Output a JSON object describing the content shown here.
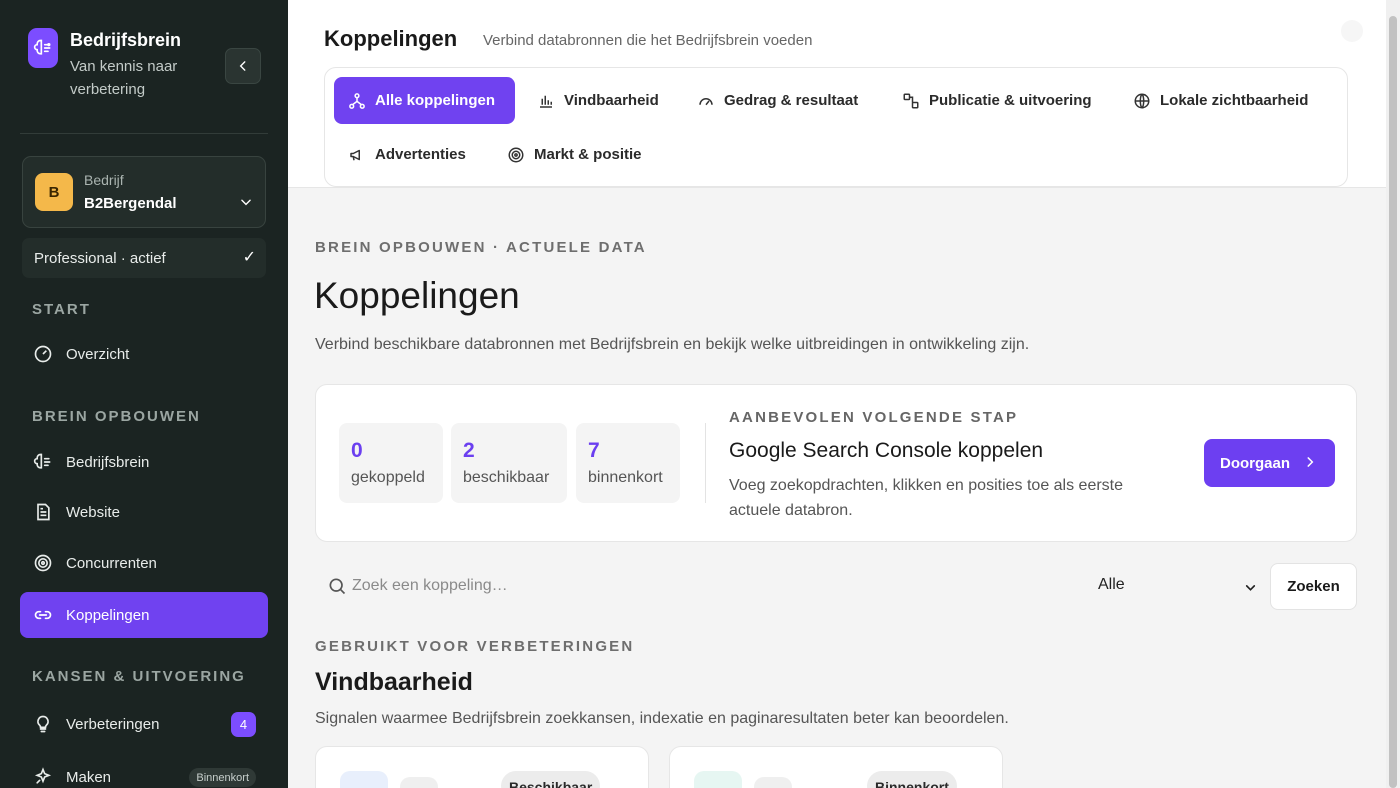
{
  "sidebar": {
    "brand_title": "Bedrijfsbrein",
    "brand_subtitle": "Van kennis naar verbetering",
    "company_label": "Bedrijf",
    "company_name": "B2Bergendal",
    "company_initial": "B",
    "plan": "Professional · actief",
    "sections": {
      "start": "START",
      "brein": "BREIN OPBOUWEN",
      "kansen": "KANSEN & UITVOERING"
    },
    "items": [
      {
        "label": "Overzicht",
        "icon": "gauge-icon"
      },
      {
        "label": "Bedrijfsbrein",
        "icon": "brain-icon"
      },
      {
        "label": "Website",
        "icon": "document-icon"
      },
      {
        "label": "Concurrenten",
        "icon": "target-icon"
      },
      {
        "label": "Koppelingen",
        "icon": "link-icon",
        "active": true
      },
      {
        "label": "Verbeteringen",
        "icon": "lightbulb-icon",
        "count": "4"
      },
      {
        "label": "Maken",
        "icon": "sparkle-icon",
        "badge": "Binnenkort"
      }
    ]
  },
  "header": {
    "title": "Koppelingen",
    "subtitle": "Verbind databronnen die het Bedrijfsbrein voeden",
    "tabs": [
      {
        "label": "Alle koppelingen",
        "icon": "network-icon",
        "active": true
      },
      {
        "label": "Vindbaarheid",
        "icon": "bar-chart-icon"
      },
      {
        "label": "Gedrag & resultaat",
        "icon": "speedometer-icon"
      },
      {
        "label": "Publicatie & uitvoering",
        "icon": "workflow-icon"
      },
      {
        "label": "Lokale zichtbaarheid",
        "icon": "globe-icon"
      },
      {
        "label": "Advertenties",
        "icon": "megaphone-icon"
      },
      {
        "label": "Markt & positie",
        "icon": "target-icon"
      }
    ]
  },
  "main": {
    "eyebrow": "BREIN OPBOUWEN · ACTUELE DATA",
    "title": "Koppelingen",
    "description": "Verbind beschikbare databronnen met Bedrijfsbrein en bekijk welke uitbreidingen in ontwikkeling zijn.",
    "stats": [
      {
        "value": "0",
        "label": "gekoppeld"
      },
      {
        "value": "2",
        "label": "beschikbaar"
      },
      {
        "value": "7",
        "label": "binnenkort"
      }
    ],
    "recommendation": {
      "eyebrow": "AANBEVOLEN VOLGENDE STAP",
      "title": "Google Search Console koppelen",
      "description": "Voeg zoekopdrachten, klikken en posities toe als eerste actuele databron.",
      "button": "Doorgaan"
    },
    "search": {
      "placeholder": "Zoek een koppeling…",
      "filter_value": "Alle",
      "button": "Zoeken"
    },
    "section": {
      "eyebrow": "GEBRUIKT VOOR VERBETERINGEN",
      "title": "Vindbaarheid",
      "description": "Signalen waarmee Bedrijfsbrein zoekkansen, indexatie en paginaresultaten beter kan beoordelen."
    },
    "cards": [
      {
        "badge": "Beschikbaar"
      },
      {
        "badge": "Binnenkort"
      }
    ]
  },
  "colors": {
    "accent": "#7042f0",
    "sidebar_bg": "#1b2422",
    "company_badge": "#f4b84a"
  }
}
